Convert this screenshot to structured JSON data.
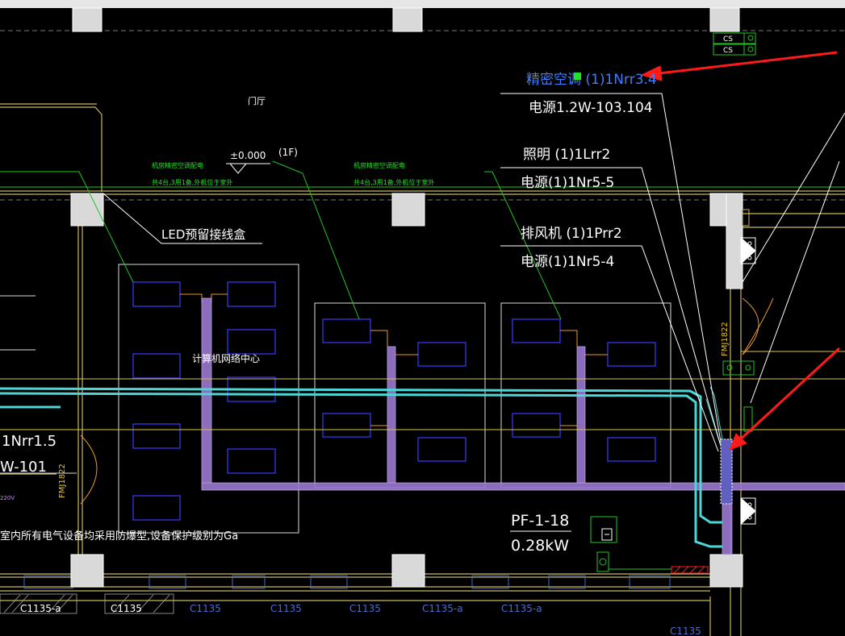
{
  "colors": {
    "background": "#000000",
    "wall": "#c8b860",
    "column": "#d9d9d9",
    "purple_tray": "#9b78d2",
    "cyan_pipe": "#4cd6d6",
    "green_leader": "#22c322",
    "white_text": "#ffffff",
    "blue_text": "#3f7fff",
    "arrow_red": "#ff1a1a",
    "equipment_blue": "#3a3aff"
  },
  "labels": {
    "hall": "门厅",
    "level": "±0.000",
    "floor": "(1F)",
    "led_box": "LED预留接线盒",
    "room_name": "计算机网络中心",
    "precision_ac": "精密空调 (1)1Nrr3.4",
    "power_main": "电源1.2W-103.104",
    "lighting": "照明 (1)1Lrr2",
    "power_5_5": "电源(1)1Nr5-5",
    "exhaust_fan": "排风机 (1)1Prr2",
    "power_5_4": "电源(1)1Nr5-4",
    "pf_id": "PF-1-18",
    "pf_power": "0.28kW",
    "left_circuit": "1Nrr1.5",
    "left_power": "W-101",
    "left_voltage": "220V",
    "note_bottom": "室内所有电气设备均采用防爆型,设备保护级别为Ga",
    "note_green_1a": "机房精密空调配电",
    "note_green_1b": "共4台,3用1备,外机位于室外",
    "note_green_2a": "机房精密空调配电",
    "note_green_2b": "共4台,3用1备,外机位于室外",
    "door_left": "FMJ1822",
    "door_right": "FMJ1822",
    "cs": "CS",
    "c1135_a": "C1135-a",
    "c1135": "C1135"
  }
}
